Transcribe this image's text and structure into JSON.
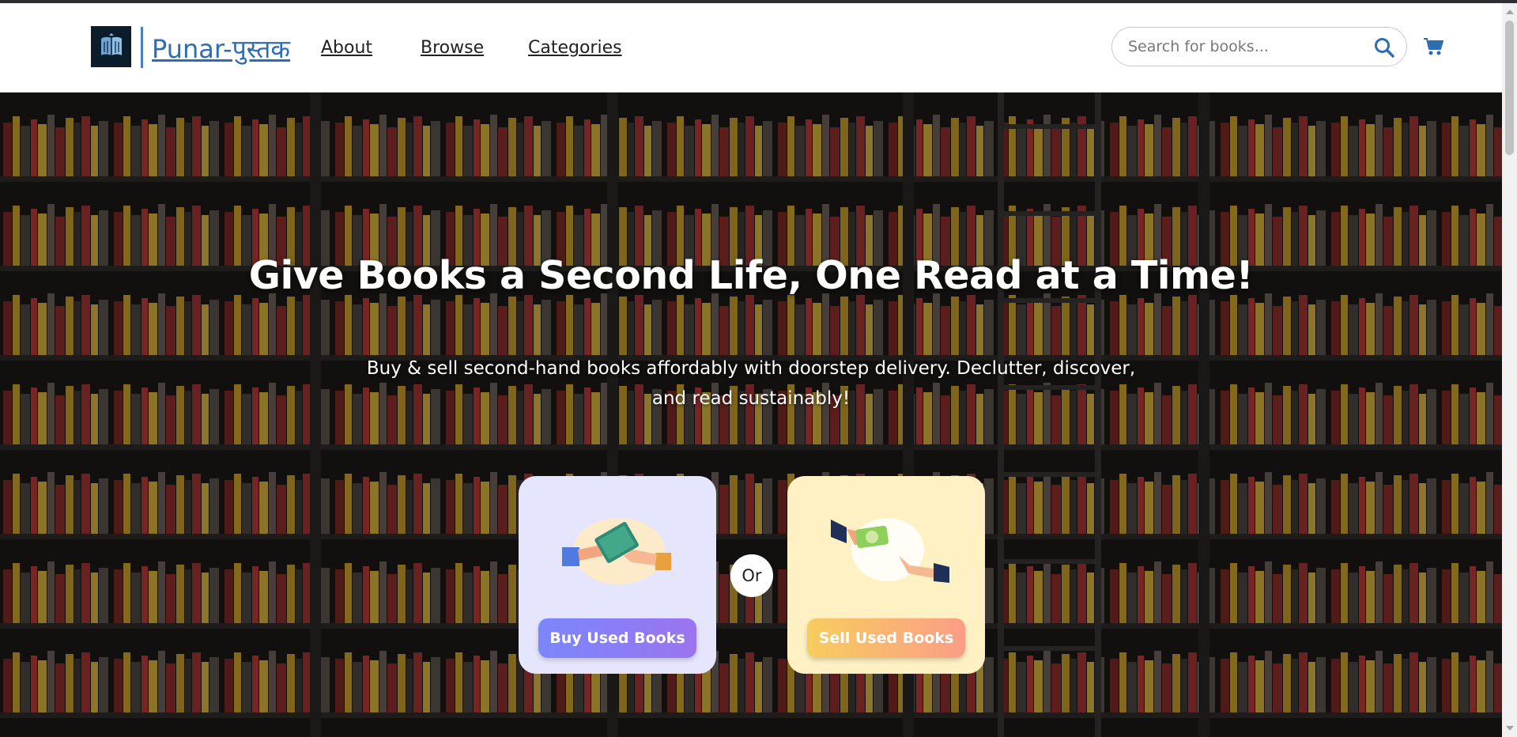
{
  "header": {
    "brand": "Punar-पुस्तक",
    "logo_icon": "book-logo-icon",
    "nav": [
      {
        "label": "About"
      },
      {
        "label": "Browse"
      },
      {
        "label": "Categories"
      }
    ],
    "search": {
      "placeholder": "Search for books...",
      "icon": "search-icon"
    },
    "cart_icon": "cart-icon"
  },
  "hero": {
    "title": "Give Books a Second Life, One Read at a Time!",
    "subtitle": "Buy & sell second-hand books affordably with doorstep delivery. Declutter, discover, and read sustainably!",
    "background": "bookshelf-image",
    "buy_card": {
      "button": "Buy Used Books",
      "color": "#e6e5fe",
      "illustration": "book-handover-icon"
    },
    "or_label": "Or",
    "sell_card": {
      "button": "Sell Used Books",
      "color": "#fff1c4",
      "illustration": "money-handover-icon"
    }
  },
  "colors": {
    "brand": "#2f6db3",
    "buy_gradient": [
      "#7a87fb",
      "#9b74f0"
    ],
    "sell_gradient": [
      "#f7cd5e",
      "#fb9d86"
    ]
  }
}
